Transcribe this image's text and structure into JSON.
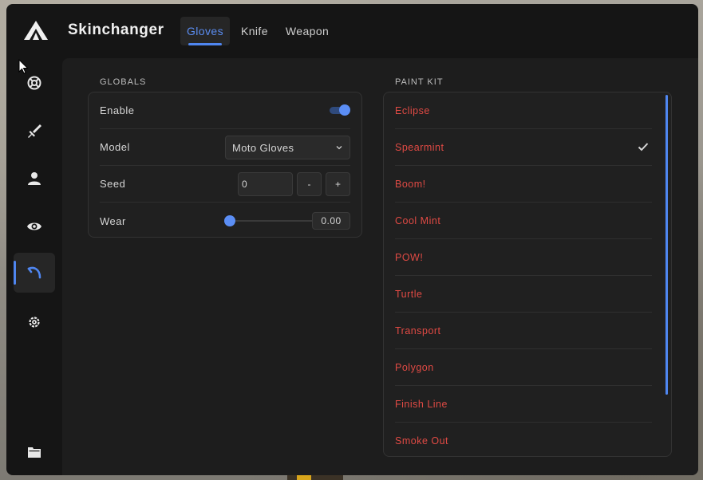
{
  "app": {
    "title": "Skinchanger",
    "accent_color": "#4f86f0",
    "paint_kit_color": "#e04a44"
  },
  "header": {
    "tabs": [
      {
        "label": "Gloves",
        "active": true
      },
      {
        "label": "Knife",
        "active": false
      },
      {
        "label": "Weapon",
        "active": false
      }
    ]
  },
  "sidebar": {
    "items": [
      {
        "icon": "lifebuoy-icon",
        "active": false
      },
      {
        "icon": "sword-icon",
        "active": false
      },
      {
        "icon": "user-icon",
        "active": false
      },
      {
        "icon": "eye-icon",
        "active": false
      },
      {
        "icon": "skinchanger-icon",
        "active": true
      },
      {
        "icon": "gear-icon",
        "active": false
      },
      {
        "icon": "folder-icon",
        "active": false
      }
    ]
  },
  "globals": {
    "section_label": "GLOBALS",
    "enable": {
      "label": "Enable",
      "value": true
    },
    "model": {
      "label": "Model",
      "value": "Moto Gloves"
    },
    "seed": {
      "label": "Seed",
      "value": "0",
      "minus": "-",
      "plus": "+"
    },
    "wear": {
      "label": "Wear",
      "value": "0.00",
      "fraction": 0.0
    }
  },
  "paint_kit": {
    "section_label": "PAINT KIT",
    "items": [
      {
        "label": "Eclipse",
        "selected": false
      },
      {
        "label": "Spearmint",
        "selected": true
      },
      {
        "label": "Boom!",
        "selected": false
      },
      {
        "label": "Cool Mint",
        "selected": false
      },
      {
        "label": "POW!",
        "selected": false
      },
      {
        "label": "Turtle",
        "selected": false
      },
      {
        "label": "Transport",
        "selected": false
      },
      {
        "label": "Polygon",
        "selected": false
      },
      {
        "label": "Finish Line",
        "selected": false
      },
      {
        "label": "Smoke Out",
        "selected": false
      }
    ]
  }
}
